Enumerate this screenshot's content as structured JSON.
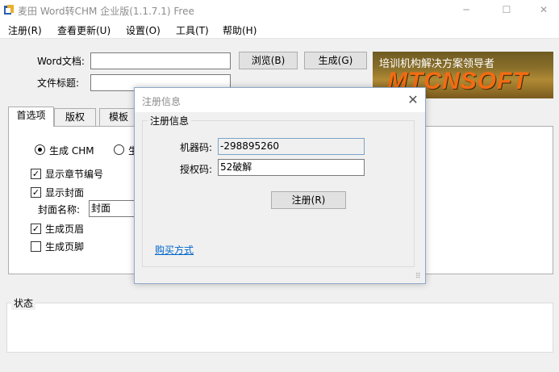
{
  "window": {
    "title": "麦田 Word转CHM 企业版(1.1.7.1) Free",
    "minimize": "─",
    "maximize": "☐",
    "close": "✕"
  },
  "menu": [
    "注册(R)",
    "查看更新(U)",
    "设置(O)",
    "工具(T)",
    "帮助(H)"
  ],
  "form": {
    "word_doc_label": "Word文档:",
    "word_doc_value": "",
    "file_title_label": "文件标题:",
    "file_title_value": "",
    "browse_button": "浏览(B)",
    "generate_button": "生成(G)"
  },
  "banner": {
    "slogan": "培训机构解决方案领导者",
    "brand": "MTCNSOFT"
  },
  "tabs": [
    "首选项",
    "版权",
    "模板"
  ],
  "options": {
    "radio_chm": "生成 CHM",
    "radio_second": "生",
    "radio_chm_selected": true,
    "show_chapter_numbers": "显示章节编号",
    "show_chapter_numbers_checked": true,
    "show_cover": "显示封面",
    "show_cover_checked": true,
    "cover_name_label": "封面名称:",
    "cover_name_value": "封面",
    "gen_header": "生成页眉",
    "gen_header_checked": true,
    "gen_footer": "生成页脚",
    "gen_footer_checked": false
  },
  "status": {
    "label": "状态"
  },
  "dialog": {
    "title": "注册信息",
    "close": "✕",
    "group_title": "注册信息",
    "machine_code_label": "机器码:",
    "machine_code_value": "-298895260",
    "auth_code_label": "授权码:",
    "auth_code_value": "52破解",
    "register_button": "注册(R)",
    "purchase_link": "购买方式"
  }
}
